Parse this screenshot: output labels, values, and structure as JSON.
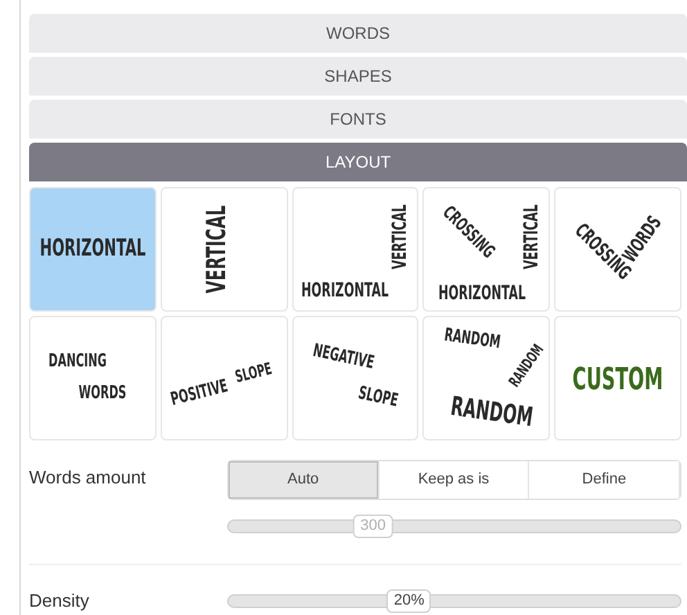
{
  "sections": [
    {
      "label": "WORDS",
      "selected": false
    },
    {
      "label": "SHAPES",
      "selected": false
    },
    {
      "label": "FONTS",
      "selected": false
    },
    {
      "label": "LAYOUT",
      "selected": true
    }
  ],
  "layouts": [
    {
      "kind": "horizontal",
      "selected": true,
      "words": [
        "HORIZONTAL"
      ]
    },
    {
      "kind": "vertical",
      "selected": false,
      "words": [
        "VERTICAL"
      ]
    },
    {
      "kind": "horizontal-vertical",
      "selected": false,
      "words": [
        "HORIZONTAL",
        "VERTICAL"
      ]
    },
    {
      "kind": "crossing-vertical",
      "selected": false,
      "words": [
        "CROSSING",
        "VERTICAL",
        "HORIZONTAL"
      ]
    },
    {
      "kind": "crossing-words",
      "selected": false,
      "words": [
        "CROSSING",
        "WORDS"
      ]
    },
    {
      "kind": "dancing",
      "selected": false,
      "words": [
        "DANCING",
        "WORDS"
      ]
    },
    {
      "kind": "positive-slope",
      "selected": false,
      "words": [
        "POSITIVE",
        "SLOPE"
      ]
    },
    {
      "kind": "negative-slope",
      "selected": false,
      "words": [
        "NEGATIVE",
        "SLOPE"
      ]
    },
    {
      "kind": "random",
      "selected": false,
      "words": [
        "RANDOM",
        "RANDOM",
        "RANDOM"
      ]
    },
    {
      "kind": "custom",
      "selected": false,
      "words": [
        "CUSTOM"
      ]
    }
  ],
  "words_amount": {
    "label": "Words amount",
    "options": [
      {
        "label": "Auto",
        "selected": true
      },
      {
        "label": "Keep as is",
        "selected": false
      },
      {
        "label": "Define",
        "selected": false
      }
    ],
    "slider": {
      "reading": "300",
      "level": 0.32,
      "disabled": true
    }
  },
  "density": {
    "label": "Density",
    "slider": {
      "reading": "20%",
      "level": 0.4,
      "disabled": false
    }
  }
}
